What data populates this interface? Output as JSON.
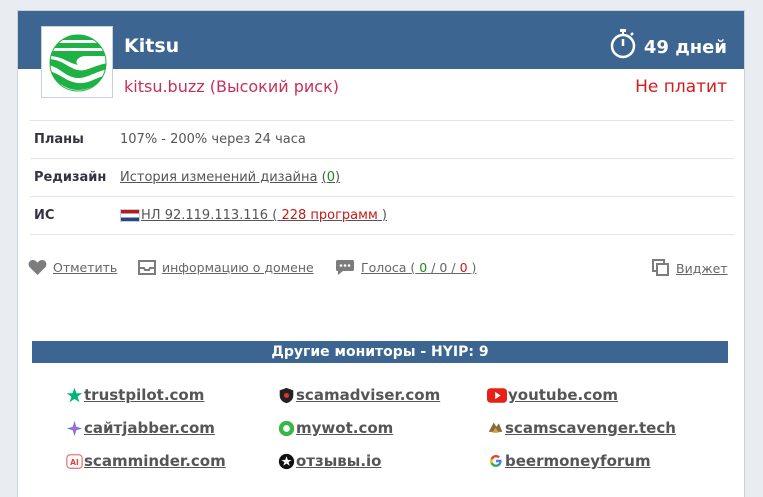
{
  "header": {
    "site_name": "Kitsu",
    "days": "49 дней",
    "subline": "kitsu.buzz (Высокий риск)",
    "pay_status": "Не платит",
    "colors": {
      "header_bg": "#3c6592",
      "subline": "#c8305a",
      "pay_status": "#d61a1a"
    }
  },
  "rows": {
    "plans_label": "Планы",
    "plans_value": "107% - 200% через 24 часа",
    "redesign_label": "Редизайн",
    "redesign_link": "История изменений дизайна",
    "redesign_count_open": "(",
    "redesign_count": "0",
    "redesign_count_close": ")",
    "ip_label": "ИС",
    "ip_country": "НЛ",
    "ip_address": "92.119.113.116",
    "ip_programs_open": "(",
    "ip_programs": "228 программ",
    "ip_programs_close": ")"
  },
  "actions": {
    "mark": "Отметить",
    "domain_info": "информацию о домене",
    "votes_label": "Голоса (",
    "votes_pos": "0",
    "votes_neu": "0",
    "votes_neg": "0",
    "votes_sep": "/",
    "votes_close": ")",
    "widget": "Виджет"
  },
  "monitors": {
    "title": "Другие мониторы - HYIP: 9",
    "items": [
      {
        "label": "trustpilot.com",
        "icon": "trustpilot-star-icon"
      },
      {
        "label": "scamadviser.com",
        "icon": "scamadviser-shield-icon"
      },
      {
        "label": "youtube.com",
        "icon": "youtube-icon"
      },
      {
        "label": "сайтjabber.com",
        "icon": "sitejabber-icon"
      },
      {
        "label": "mywot.com",
        "icon": "mywot-icon"
      },
      {
        "label": "scamscavenger.tech",
        "icon": "scamscavenger-icon"
      },
      {
        "label": "scamminder.com",
        "icon": "scamminder-icon"
      },
      {
        "label": "отзывы.io",
        "icon": "otzyvy-star-icon"
      },
      {
        "label": "beermoneyforum",
        "icon": "google-icon"
      }
    ]
  }
}
